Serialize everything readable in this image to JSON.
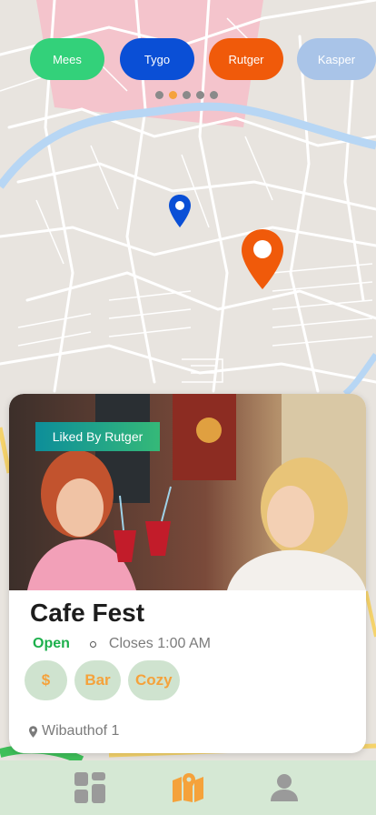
{
  "users": [
    {
      "label": "Mees",
      "color": "#33d17a"
    },
    {
      "label": "Tygo",
      "color": "#0a4fd6"
    },
    {
      "label": "Rutger",
      "color": "#f05a0a"
    },
    {
      "label": "Kasper",
      "color": "#a9c4e8"
    }
  ],
  "pager": {
    "count": 5,
    "active_index": 1,
    "active_color": "#f5a23b"
  },
  "place": {
    "liked_by": "Liked By Rutger",
    "name": "Cafe Fest",
    "status": "Open",
    "closes": "Closes 1:00 AM",
    "tags": [
      "$",
      "Bar",
      "Cozy"
    ],
    "address": "Wibauthof 1"
  },
  "nav": {
    "items": [
      {
        "icon": "grid-icon",
        "active": false
      },
      {
        "icon": "map-icon",
        "active": true
      },
      {
        "icon": "profile-icon",
        "active": false
      }
    ],
    "active_color": "#f5a23b",
    "inactive_color": "#9a9a9a"
  },
  "markers": [
    {
      "icon": "location-pin-icon",
      "color": "#0a4fd6"
    },
    {
      "icon": "location-pin-icon",
      "color": "#f05a0a"
    }
  ]
}
